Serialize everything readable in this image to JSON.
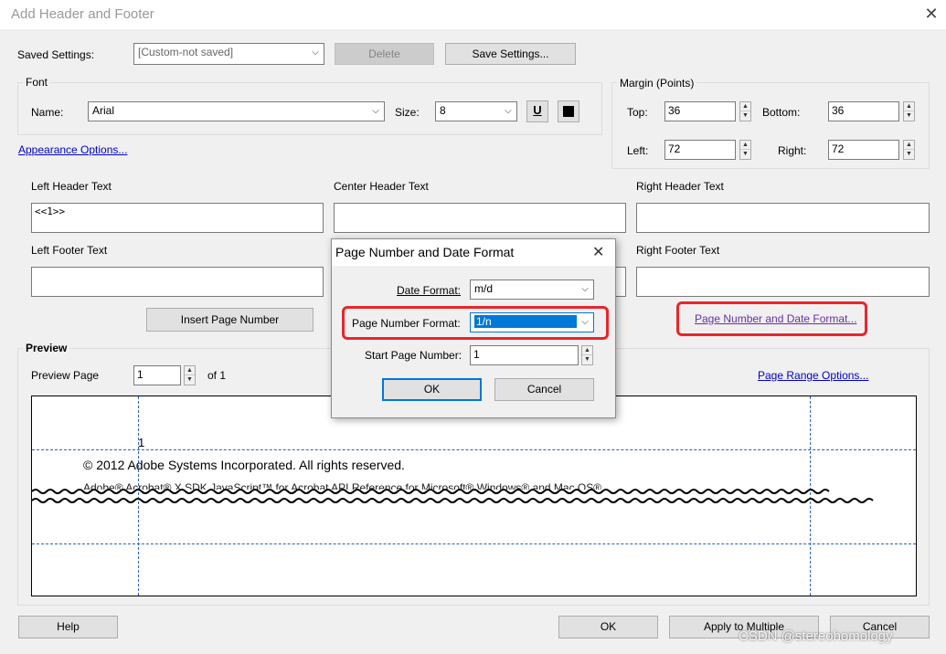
{
  "window": {
    "title": "Add Header and Footer",
    "close_glyph": "✕"
  },
  "saved_settings": {
    "label": "Saved Settings:",
    "value": "[Custom-not saved]",
    "delete_label": "Delete",
    "save_label": "Save Settings..."
  },
  "font": {
    "group_label": "Font",
    "name_label": "Name:",
    "name_value": "Arial",
    "size_label": "Size:",
    "size_value": "8",
    "underline_glyph": "U"
  },
  "margin": {
    "group_label": "Margin (Points)",
    "top_label": "Top:",
    "top_value": "36",
    "bottom_label": "Bottom:",
    "bottom_value": "36",
    "left_label": "Left:",
    "left_value": "72",
    "right_label": "Right:",
    "right_value": "72"
  },
  "appearance_link": "Appearance Options...",
  "headers": {
    "left_label": "Left Header Text",
    "left_value": "<<1>>",
    "center_label": "Center Header Text",
    "center_value": "",
    "right_label": "Right Header Text",
    "right_value": ""
  },
  "footers": {
    "left_label": "Left Footer Text",
    "left_value": "",
    "right_label": "Right Footer Text",
    "right_value": ""
  },
  "insert_page_number_label": "Insert Page Number",
  "page_number_date_link": "Page Number and Date Format...",
  "preview": {
    "group_label": "Preview",
    "page_label": "Preview Page",
    "page_value": "1",
    "of_label": "of 1",
    "range_link": "Page Range Options...",
    "header_sample": "1",
    "copyright_text": "© 2012 Adobe Systems Incorporated. All rights reserved.",
    "subtitle_text": "Adobe® Acrobat® X SDK JavaScript™ for Acrobat API Reference for Microsoft® Windows® and Mac OS®."
  },
  "bottom": {
    "help_label": "Help",
    "ok_label": "OK",
    "apply_label": "Apply to Multiple",
    "cancel_label": "Cancel"
  },
  "dialog": {
    "title": "Page Number and Date Format",
    "close_glyph": "✕",
    "date_format_label": "Date Format:",
    "date_format_value": "m/d",
    "page_number_format_label": "Page Number Format:",
    "page_number_format_value": "1/n",
    "start_page_label": "Start Page Number:",
    "start_page_value": "1",
    "ok_label": "OK",
    "cancel_label": "Cancel"
  },
  "watermark": "CSDN @stereohomology",
  "colors": {
    "highlight": "#e8262b",
    "accent": "#0078d7",
    "link": "#0000cc",
    "selection": "#0078d7"
  }
}
